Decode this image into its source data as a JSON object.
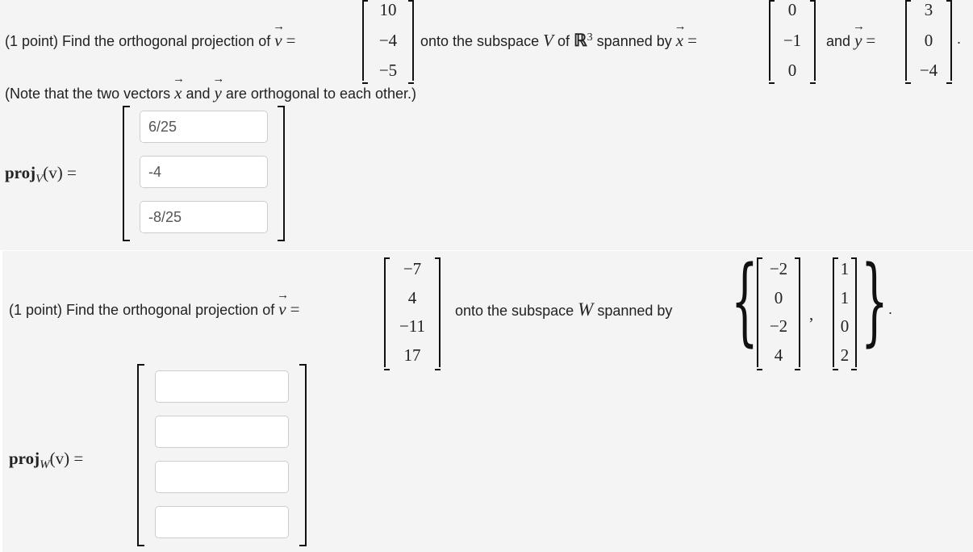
{
  "problem1": {
    "intro": "(1 point) Find the orthogonal projection of",
    "v_label": "v",
    "equals": "=",
    "v": [
      "10",
      "−4",
      "−5"
    ],
    "mid1": "onto the subspace",
    "V": "V",
    "of": "of",
    "R": "ℝ",
    "R_exp": "3",
    "spanned": "spanned by",
    "x_label": "x",
    "x": [
      "0",
      "−1",
      "0"
    ],
    "and": "and",
    "y_label": "y",
    "y": [
      "3",
      "0",
      "−4"
    ],
    "period": ".",
    "note": "(Note that the two vectors",
    "note_x": "x",
    "note_and": "and",
    "note_y": "y",
    "note_end": "are orthogonal to each other.)",
    "answer_label": "proj",
    "answer_sub": "V",
    "answer_arg": "(v) =",
    "answers": [
      "6/25",
      "-4",
      "-8/25"
    ],
    "keyboard_icon": "grid-keypad-icon"
  },
  "problem2": {
    "intro": "(1 point) Find the orthogonal projection of",
    "v_label": "v",
    "equals": "=",
    "v": [
      "−7",
      "4",
      "−11",
      "17"
    ],
    "mid": "onto the subspace",
    "W": "W",
    "spanned": "spanned by",
    "basis1": [
      "−2",
      "0",
      "−2",
      "4"
    ],
    "basis2": [
      "1",
      "1",
      "0",
      "2"
    ],
    "comma": ",",
    "period": ".",
    "answer_label": "proj",
    "answer_sub": "W",
    "answer_arg": "(v) =",
    "answers": [
      "",
      "",
      "",
      ""
    ],
    "keyboard_icon": "grid-keypad-icon"
  }
}
